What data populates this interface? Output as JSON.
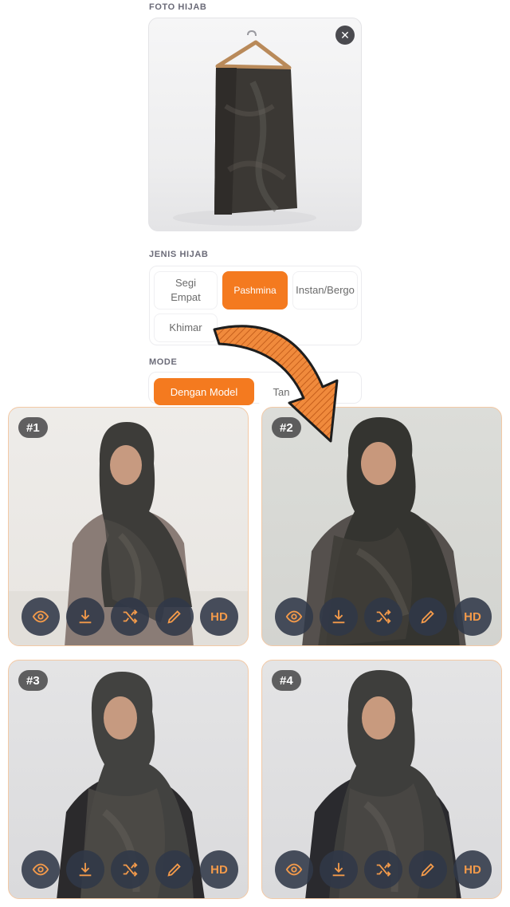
{
  "foto": {
    "label": "FOTO HIJAB",
    "close_icon": "close-icon"
  },
  "jenis": {
    "label": "JENIS HIJAB",
    "options": [
      {
        "label": "Segi\nEmpat",
        "active": false
      },
      {
        "label": "Pashmina",
        "active": true
      },
      {
        "label": "Instan/Bergo",
        "active": false
      },
      {
        "label": "Khimar",
        "active": false
      }
    ]
  },
  "mode": {
    "label": "MODE",
    "options": [
      {
        "label": "Dengan Model",
        "active": true
      },
      {
        "label": "Tan",
        "active": false
      }
    ]
  },
  "results": [
    {
      "badge": "#1"
    },
    {
      "badge": "#2"
    },
    {
      "badge": "#3"
    },
    {
      "badge": "#4"
    }
  ],
  "actions": {
    "hd_label": "HD",
    "icons": [
      "eye-icon",
      "download-icon",
      "shuffle-icon",
      "pencil-icon"
    ]
  },
  "colors": {
    "accent": "#f47a1f",
    "action_bg": "#303848",
    "action_icon": "#f39a4a"
  }
}
